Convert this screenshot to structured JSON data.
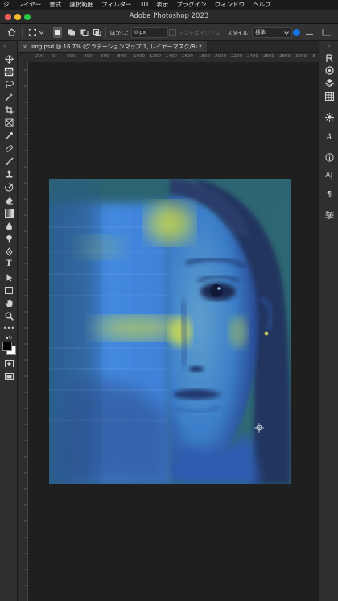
{
  "menu": [
    "ジ",
    "レイヤー",
    "書式",
    "選択範囲",
    "フィルター",
    "3D",
    "表示",
    "プラグイン",
    "ウィンドウ",
    "ヘルプ"
  ],
  "window": {
    "title": "Adobe Photoshop 2023"
  },
  "options": {
    "feather_label": "ぼかし：",
    "feather_value": "0 px",
    "antialias_label": "アンチエイリアス",
    "style_label": "スタイル：",
    "style_value": "標準"
  },
  "document_tab": {
    "label": "img.psd @ 16.7% (グラデーションマップ 1, レイヤーマスク/8) *"
  },
  "ruler": {
    "marks": [
      "200",
      "0",
      "200",
      "400",
      "600",
      "800",
      "1000",
      "1200",
      "1400",
      "1600",
      "1800",
      "2000",
      "2200",
      "2400",
      "2600",
      "2800",
      "3000",
      "3"
    ]
  },
  "colors": {
    "foreground": "#000000",
    "background": "#ffffff",
    "accent": "#1473e6",
    "image_blue": "#3f86e8",
    "image_yellow": "#c9d84a"
  },
  "tools": [
    "move-icon",
    "marquee-icon",
    "lasso-icon",
    "magic-wand-icon",
    "crop-icon",
    "frame-icon",
    "eyedropper-icon",
    "healing-brush-icon",
    "brush-icon",
    "clone-stamp-icon",
    "history-brush-icon",
    "eraser-icon",
    "gradient-icon",
    "blur-icon",
    "dodge-icon",
    "pen-icon",
    "type-icon",
    "path-select-icon",
    "shape-icon",
    "hand-icon",
    "zoom-icon",
    "more-tools-icon"
  ],
  "right_panels": [
    "history-icon",
    "color-icon",
    "layers-icon",
    "channels-icon",
    "adjustments-icon",
    "glyphs-icon",
    "info-icon",
    "character-icon",
    "paragraph-icon",
    "properties-icon"
  ]
}
